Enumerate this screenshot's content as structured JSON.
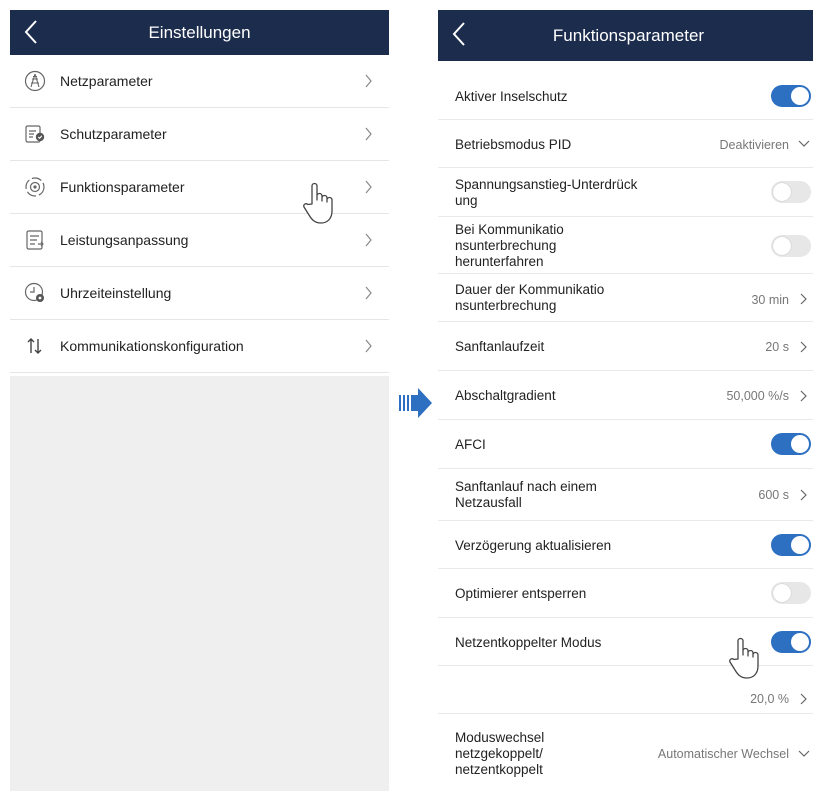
{
  "left": {
    "header": {
      "title": "Einstellungen",
      "back_icon": "back-chevron-icon"
    },
    "menu": [
      {
        "label": "Netzparameter",
        "icon": "grid-tower-icon"
      },
      {
        "label": "Schutzparameter",
        "icon": "protection-list-icon"
      },
      {
        "label": "Funktionsparameter",
        "icon": "function-gear-icon"
      },
      {
        "label": "Leistungsanpassung",
        "icon": "power-adjust-icon"
      },
      {
        "label": "Uhrzeiteinstellung",
        "icon": "clock-settings-icon"
      },
      {
        "label": "Kommunikationskonfiguration",
        "icon": "up-down-arrows-icon"
      }
    ]
  },
  "right": {
    "header": {
      "title": "Funktionsparameter",
      "back_icon": "back-chevron-icon"
    },
    "rows": [
      {
        "label": "Aktiver Inselschutz",
        "type": "toggle",
        "on": true
      },
      {
        "label": "Betriebsmodus PID",
        "type": "select",
        "value": "Deaktivieren"
      },
      {
        "label": "Spannungsanstieg-Unterdrück\nung",
        "type": "toggle",
        "on": false
      },
      {
        "label": "Bei Kommunikatio\nnsunterbrechung\nherunterfahren",
        "type": "toggle",
        "on": false
      },
      {
        "label": "Dauer der Kommunikatio\nnsunterbrechung",
        "type": "link",
        "value": "30 min"
      },
      {
        "label": "Sanftanlaufzeit",
        "type": "link",
        "value": "20 s"
      },
      {
        "label": "Abschaltgradient",
        "type": "link",
        "value": "50,000 %/s"
      },
      {
        "label": "AFCI",
        "type": "toggle",
        "on": true
      },
      {
        "label": "Sanftanlauf nach einem\nNetzausfall",
        "type": "link",
        "value": "600 s"
      },
      {
        "label": "Verzögerung aktualisieren",
        "type": "toggle",
        "on": true
      },
      {
        "label": "Optimierer entsperren",
        "type": "toggle",
        "on": false
      },
      {
        "label": "Netzentkoppelter Modus",
        "type": "toggle",
        "on": true
      },
      {
        "label": "",
        "type": "link",
        "value": "20,0 %"
      },
      {
        "label": "Moduswechsel\nnetzgekoppelt/\nnetzentkoppelt",
        "type": "select",
        "value": "Automatischer Wechsel"
      }
    ]
  },
  "colors": {
    "header_bg": "#1c2c4d",
    "toggle_on": "#2d6fc1",
    "toggle_off": "#e7e7e7",
    "arrow": "#2d6fc1",
    "left_empty_bg": "#efefef"
  }
}
